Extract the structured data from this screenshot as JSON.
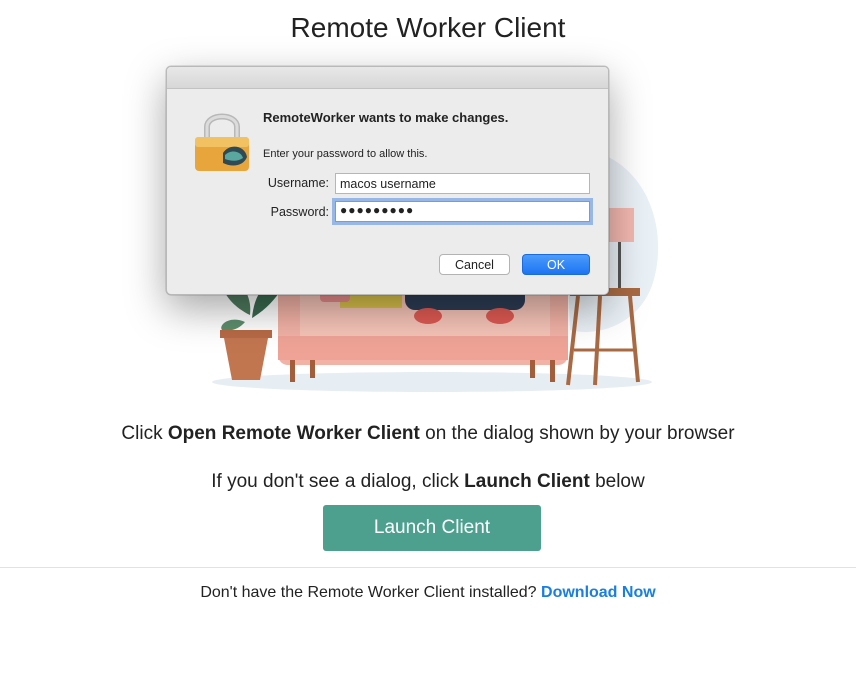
{
  "page": {
    "title": "Remote Worker Client"
  },
  "dialog": {
    "heading": "RemoteWorker wants to make changes.",
    "message": "Enter your password to allow this.",
    "username_label": "Username:",
    "username_value": "macos username",
    "password_label": "Password:",
    "password_value": "●●●●●●●●●",
    "cancel_label": "Cancel",
    "ok_label": "OK"
  },
  "instructions": {
    "line1_prefix": "Click ",
    "line1_bold": "Open Remote Worker Client",
    "line1_suffix": " on the dialog shown by your browser",
    "line2_prefix": "If you don't see a dialog, click ",
    "line2_bold": "Launch Client",
    "line2_suffix": " below"
  },
  "launch_button": {
    "label": "Launch Client"
  },
  "footer": {
    "text": "Don't have the Remote Worker Client installed? ",
    "link": "Download Now"
  },
  "colors": {
    "launch_button": "#4d9f8e",
    "link": "#1a7fe0",
    "ok_button": "#1d74f2"
  }
}
